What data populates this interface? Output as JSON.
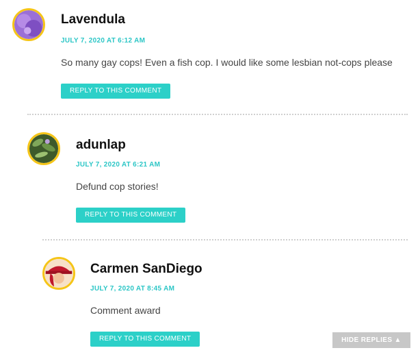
{
  "comments": [
    {
      "author": "Lavendula",
      "date": "JULY 7, 2020 AT 6:12 AM",
      "text": "So many gay cops! Even a fish cop. I would like some lesbian not-cops please",
      "reply_label": "REPLY TO THIS COMMENT",
      "avatar_icon": "purple-abstract-avatar"
    },
    {
      "author": "adunlap",
      "date": "JULY 7, 2020 AT 6:21 AM",
      "text": "Defund cop stories!",
      "reply_label": "REPLY TO THIS COMMENT",
      "avatar_icon": "plant-photo-avatar"
    },
    {
      "author": "Carmen SanDiego",
      "date": "JULY 7, 2020 AT 8:45 AM",
      "text": "Comment award",
      "reply_label": "REPLY TO THIS COMMENT",
      "avatar_icon": "red-hat-character-avatar"
    }
  ],
  "hide_replies_label": "HIDE REPLIES ▲",
  "colors": {
    "accent": "#2cd0c8",
    "date": "#2cc6c6",
    "avatar_border": "#f5c518",
    "hide_replies_bg": "#c7c7c7"
  }
}
